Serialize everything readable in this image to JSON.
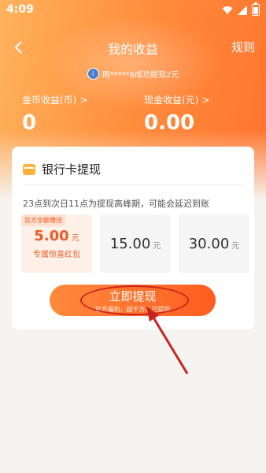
{
  "status_bar": {
    "time": "4:09"
  },
  "nav": {
    "title": "我的收益",
    "rules": "规则"
  },
  "notice": {
    "avatar_letter": "i",
    "text": "用*****6成功提现2元"
  },
  "balances": {
    "coin": {
      "label": "金币收益(币)",
      "chevron": ">",
      "value": "0"
    },
    "cash": {
      "label": "现金收益(元)",
      "chevron": ">",
      "value": "0.00"
    }
  },
  "card": {
    "title": "银行卡提现",
    "peak_note": "23点到次日11点为提现高峰期，可能会延迟到账",
    "options": [
      {
        "tag": "官方全额赠送",
        "amount": "5.00",
        "unit": "元",
        "sub": "专属惊喜红包",
        "selected": true
      },
      {
        "tag": "",
        "amount": "15.00",
        "unit": "元",
        "sub": "",
        "selected": false
      },
      {
        "tag": "",
        "amount": "30.00",
        "unit": "元",
        "sub": "",
        "selected": false
      }
    ],
    "withdraw": {
      "label": "立即提现",
      "sub": "官方福利，超千万人已提现"
    }
  },
  "colors": {
    "accent": "#ff6a2b",
    "annotation": "#c9241e"
  }
}
